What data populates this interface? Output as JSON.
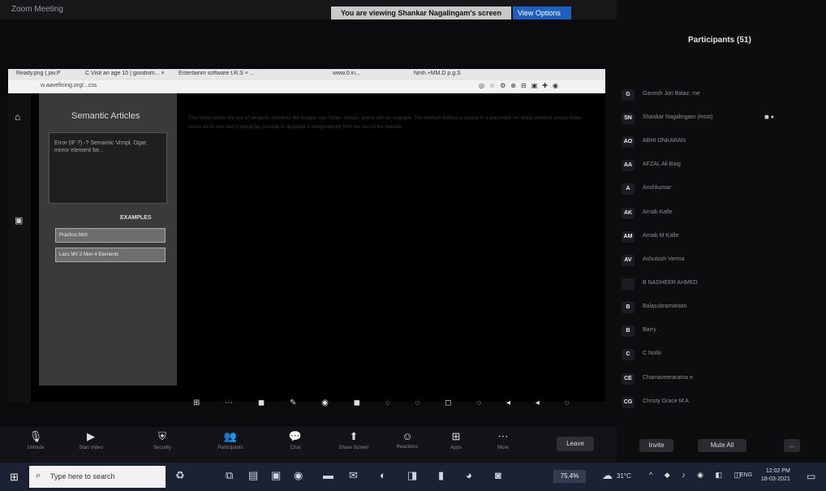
{
  "zoom": {
    "title": "Zoom Meeting",
    "share_banner": "You are viewing Shankar Nagalingam's screen",
    "view_options": "View Options"
  },
  "browser": {
    "tabs": [
      "Ready.png (.jav.P",
      "C  Visit an age 10 | goodnim...  ×",
      "Entertainm software t.R.S  ×  ...",
      "www.0.in...",
      "Nmh.+MM.D.p.g.S"
    ],
    "address": "w   aavefining.org/...css",
    "toolbar_icons": [
      "◎",
      "☆",
      "⚙",
      "⊕",
      "⊟",
      "▣",
      "✚",
      "◉"
    ]
  },
  "page": {
    "heading": "Semantic Articles",
    "box_text": "Error (IF ?)  -? Semantic  Vrmpl.  Ogar:  mirror element for...",
    "examples_label": "EXAMPLES",
    "example_1": "Practice.html",
    "example_2": "Lacs MV 2 Mon 4 Elements",
    "body_text": "This Video  shows  the  use  of  semantic  elements  like  header, nav, footer, section,  article  with  an  example.  The  element  defines  a  section  in  a  document.  An  article  element  should  make  sense  on  its  own  and  it  should  be  possible  to  distribute  it  independently  from  the  rest  of  the  website."
  },
  "participants": {
    "title": "Participants (51)",
    "list": [
      {
        "initials": "G",
        "name": "Ganesh Jon Balaz, me"
      },
      {
        "initials": "SN",
        "name": "Shankar Nagalingam (Host)"
      },
      {
        "initials": "AO",
        "name": "ABHI ONKARAN"
      },
      {
        "initials": "AA",
        "name": "AFZAL Ali Baig"
      },
      {
        "initials": "A",
        "name": "Anshkumar"
      },
      {
        "initials": "AK",
        "name": "Arnab Kafle"
      },
      {
        "initials": "AM",
        "name": "Arnab M Kafle"
      },
      {
        "initials": "AV",
        "name": "Ashutosh Verma"
      },
      {
        "initials": "",
        "name": "B NADHEER AHMED"
      },
      {
        "initials": "B",
        "name": "Balasubramanian"
      },
      {
        "initials": "B",
        "name": "Barry"
      },
      {
        "initials": "C",
        "name": "C Nolbi"
      },
      {
        "initials": "CE",
        "name": "Chamaveeraratna e"
      },
      {
        "initials": "CG",
        "name": "Christy Grace M A"
      }
    ],
    "host_status": "◼ ●",
    "invite": "Invite",
    "mute_all": "Mute All",
    "more": "..."
  },
  "controls": {
    "unmute": "Unmute",
    "start_video": "Start Video",
    "security": "Security",
    "participants": "Participants",
    "chat": "Chat",
    "share_screen": "Share Screen",
    "reactions": "Reactions",
    "apps": "Apps",
    "more": "More",
    "leave": "Leave",
    "share_toolbar": "⊞ ⋯ ◼ ✎ ◉ ◼ ◌ ◌ ◻ ◌ ◂ ◂ ◌"
  },
  "taskbar": {
    "search_placeholder": "Type here to search",
    "battery": "75.4%",
    "temperature": "31°C",
    "tray_icons": "^ ◆ ♪ ◉ ◧ ◫",
    "language": "ENG",
    "time": "12:02 PM",
    "date": "18-03-2021"
  },
  "icons": {
    "home": "home-icon",
    "start": "windows-start-icon",
    "search": "search-icon",
    "notification": "notification-icon"
  }
}
